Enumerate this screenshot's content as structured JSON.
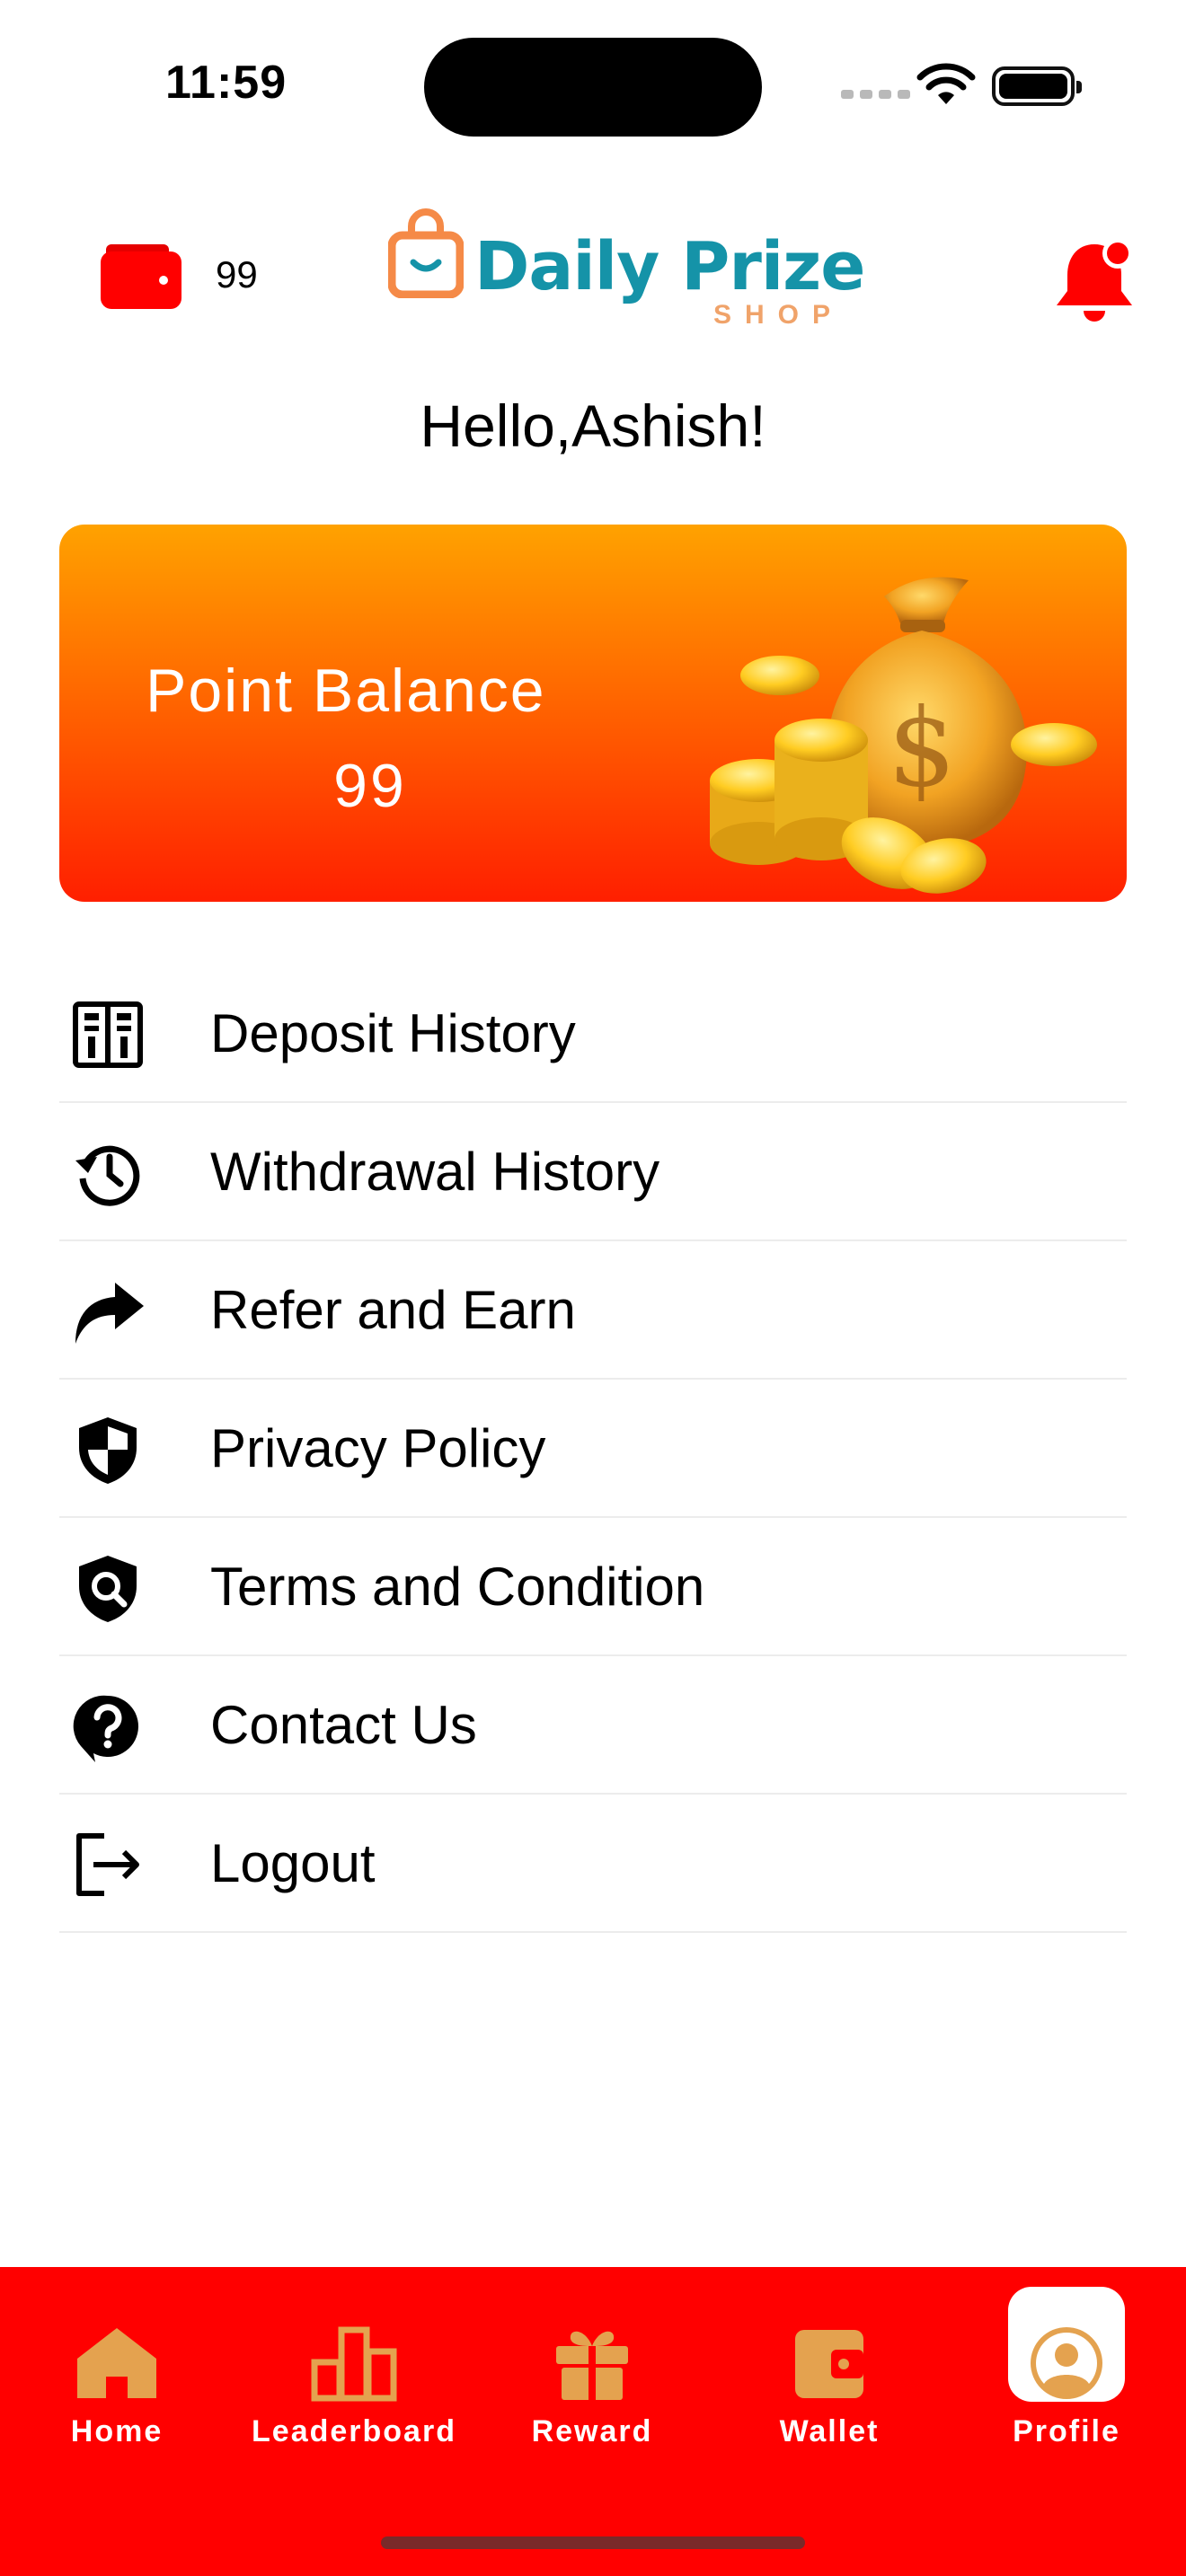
{
  "status_bar": {
    "time": "11:59"
  },
  "header": {
    "wallet_points": "99",
    "logo_name": "Daily Prize",
    "logo_sub": "SHOP"
  },
  "greeting": "Hello,Ashish!",
  "balance_card": {
    "label": "Point Balance",
    "value": "99"
  },
  "menu": [
    {
      "label": "Deposit History",
      "icon": "ledger-icon"
    },
    {
      "label": "Withdrawal History",
      "icon": "history-icon"
    },
    {
      "label": "Refer and Earn",
      "icon": "share-arrow-icon"
    },
    {
      "label": "Privacy Policy",
      "icon": "shield-icon"
    },
    {
      "label": "Terms and Condition",
      "icon": "shield-search-icon"
    },
    {
      "label": "Contact Us",
      "icon": "help-icon"
    },
    {
      "label": "Logout",
      "icon": "logout-icon"
    }
  ],
  "tabs": [
    {
      "label": "Home",
      "icon": "home-icon"
    },
    {
      "label": "Leaderboard",
      "icon": "leaderboard-icon"
    },
    {
      "label": "Reward",
      "icon": "gift-icon"
    },
    {
      "label": "Wallet",
      "icon": "wallet-icon"
    },
    {
      "label": "Profile",
      "icon": "profile-icon",
      "active": true
    }
  ],
  "colors": {
    "brand_red": "#ff0000",
    "card_top": "#ffa200",
    "card_bottom": "#ff1f00",
    "tab_icon": "#e4a24f",
    "logo_teal": "#1593a8"
  }
}
